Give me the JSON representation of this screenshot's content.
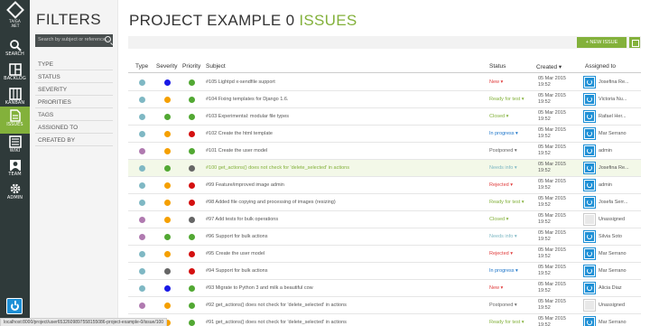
{
  "nav": {
    "logo_text": "TAIGA .NET",
    "items": [
      {
        "label": "SEARCH",
        "icon": "search-icon"
      },
      {
        "label": "BACKLOG",
        "icon": "backlog-icon"
      },
      {
        "label": "KANBAN",
        "icon": "kanban-icon"
      },
      {
        "label": "ISSUES",
        "icon": "issues-icon"
      },
      {
        "label": "WIKI",
        "icon": "wiki-icon"
      },
      {
        "label": "TEAM",
        "icon": "team-icon"
      },
      {
        "label": "ADMIN",
        "icon": "gear-icon"
      }
    ],
    "active_color": "#83b13b"
  },
  "filters": {
    "title": "FILTERS",
    "search_placeholder": "Search by subject or reference...",
    "categories": [
      "TYPE",
      "STATUS",
      "SEVERITY",
      "PRIORITIES",
      "TAGS",
      "ASSIGNED TO",
      "CREATED BY"
    ]
  },
  "page": {
    "title_main": "PROJECT EXAMPLE 0",
    "title_accent": "ISSUES",
    "new_issue_label": "+ NEW ISSUE"
  },
  "table": {
    "headers": {
      "type": "Type",
      "severity": "Severity",
      "priority": "Priority",
      "subject": "Subject",
      "status": "Status",
      "created": "Created ▾",
      "assigned": "Assigned to"
    },
    "colors": {
      "teal": "#7fb8c4",
      "blue": "#1919e6",
      "orange": "#f5a000",
      "green": "#52a833",
      "red": "#d41010",
      "grey": "#666666",
      "purple": "#b07ab0",
      "statusNew": "#e03c3c",
      "statusReady": "#83b13b",
      "statusProgress": "#1a73c8",
      "statusNeeds": "#7fb8c4",
      "statusPostponed": "#666666",
      "statusRejected": "#e03c3c"
    },
    "rows": [
      {
        "type": "teal",
        "severity": "blue",
        "priority": "green",
        "subject": "#105 Lightpd x-sendfile support",
        "status": "New ▾",
        "status_color": "statusNew",
        "date": "05 Mar 2015",
        "time": "19:52",
        "assignee": "Josefina Re...",
        "avatar": "blue",
        "hl": false
      },
      {
        "type": "teal",
        "severity": "orange",
        "priority": "green",
        "subject": "#104 Fixing templates for Django 1.6.",
        "status": "Ready for test ▾",
        "status_color": "statusReady",
        "date": "05 Mar 2015",
        "time": "19:52",
        "assignee": "Victoria Nu...",
        "avatar": "blue",
        "hl": false
      },
      {
        "type": "teal",
        "severity": "green",
        "priority": "green",
        "subject": "#103 Experimental: modular file types",
        "status": "Closed ▾",
        "status_color": "statusReady",
        "date": "05 Mar 2015",
        "time": "19:52",
        "assignee": "Rafael Her...",
        "avatar": "blue",
        "hl": false
      },
      {
        "type": "teal",
        "severity": "orange",
        "priority": "red",
        "subject": "#102 Create the html template",
        "status": "In progress ▾",
        "status_color": "statusProgress",
        "date": "05 Mar 2015",
        "time": "19:52",
        "assignee": "Mar Serrano",
        "avatar": "blue",
        "hl": false
      },
      {
        "type": "purple",
        "severity": "orange",
        "priority": "green",
        "subject": "#101 Create the user model",
        "status": "Postponed ▾",
        "status_color": "statusPostponed",
        "date": "05 Mar 2015",
        "time": "19:52",
        "assignee": "admin",
        "avatar": "blue",
        "hl": false
      },
      {
        "type": "teal",
        "severity": "green",
        "priority": "grey",
        "subject": "#100 get_actions() does not check for 'delete_selected' in actions",
        "status": "Needs info ▾",
        "status_color": "statusNeeds",
        "date": "05 Mar 2015",
        "time": "19:52",
        "assignee": "Josefina Re...",
        "avatar": "blue",
        "hl": true
      },
      {
        "type": "teal",
        "severity": "orange",
        "priority": "red",
        "subject": "#99 Feature/improved image admin",
        "status": "Rejected ▾",
        "status_color": "statusRejected",
        "date": "05 Mar 2015",
        "time": "19:52",
        "assignee": "admin",
        "avatar": "blue",
        "hl": false
      },
      {
        "type": "teal",
        "severity": "orange",
        "priority": "red",
        "subject": "#98 Added file copying and processing of images (resizing)",
        "status": "Ready for test ▾",
        "status_color": "statusReady",
        "date": "05 Mar 2015",
        "time": "19:52",
        "assignee": "Josefa Serr...",
        "avatar": "blue",
        "hl": false
      },
      {
        "type": "purple",
        "severity": "orange",
        "priority": "grey",
        "subject": "#97 Add tests for bulk operations",
        "status": "Closed ▾",
        "status_color": "statusReady",
        "date": "05 Mar 2015",
        "time": "19:52",
        "assignee": "Unassigned",
        "avatar": "grey",
        "hl": false
      },
      {
        "type": "purple",
        "severity": "green",
        "priority": "green",
        "subject": "#96 Support for bulk actions",
        "status": "Needs info ▾",
        "status_color": "statusNeeds",
        "date": "05 Mar 2015",
        "time": "19:52",
        "assignee": "Silvia Soto",
        "avatar": "blue",
        "hl": false
      },
      {
        "type": "teal",
        "severity": "orange",
        "priority": "red",
        "subject": "#95 Create the user model",
        "status": "Rejected ▾",
        "status_color": "statusRejected",
        "date": "05 Mar 2015",
        "time": "19:52",
        "assignee": "Mar Serrano",
        "avatar": "blue",
        "hl": false
      },
      {
        "type": "teal",
        "severity": "grey",
        "priority": "red",
        "subject": "#94 Support for bulk actions",
        "status": "In progress ▾",
        "status_color": "statusProgress",
        "date": "05 Mar 2015",
        "time": "19:52",
        "assignee": "Mar Serrano",
        "avatar": "blue",
        "hl": false
      },
      {
        "type": "teal",
        "severity": "blue",
        "priority": "green",
        "subject": "#93 Migrate to Python 3 and milk a beautiful cow",
        "status": "New ▾",
        "status_color": "statusNew",
        "date": "05 Mar 2015",
        "time": "19:52",
        "assignee": "Alicia Diaz",
        "avatar": "blue",
        "hl": false
      },
      {
        "type": "purple",
        "severity": "orange",
        "priority": "green",
        "subject": "#92 get_actions() does not check for 'delete_selected' in actions",
        "status": "Postponed ▾",
        "status_color": "statusPostponed",
        "date": "05 Mar 2015",
        "time": "19:52",
        "assignee": "Unassigned",
        "avatar": "grey",
        "hl": false
      },
      {
        "type": "teal",
        "severity": "orange",
        "priority": "green",
        "subject": "#91 get_actions() does not check for 'delete_selected' in actions",
        "status": "Ready for test ▾",
        "status_color": "statusReady",
        "date": "05 Mar 2015",
        "time": "19:52",
        "assignee": "Mar Serrano",
        "avatar": "blue",
        "hl": false
      }
    ]
  },
  "statusbar": {
    "url": "localhost:8000/project/user6532609897558155086-project-example-0/issue/100"
  }
}
